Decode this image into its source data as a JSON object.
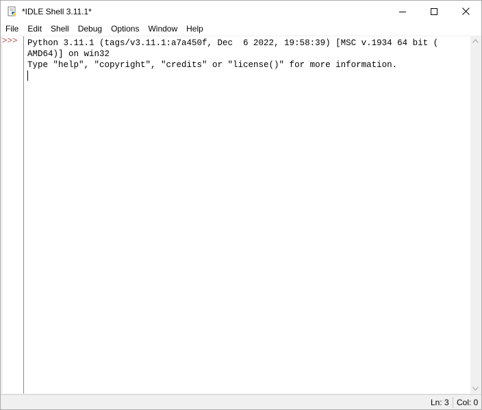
{
  "window": {
    "title": "*IDLE Shell 3.11.1*"
  },
  "menu": {
    "items": [
      "File",
      "Edit",
      "Shell",
      "Debug",
      "Options",
      "Window",
      "Help"
    ]
  },
  "shell": {
    "prompt": ">>>",
    "lines": [
      "Python 3.11.1 (tags/v3.11.1:a7a450f, Dec  6 2022, 19:58:39) [MSC v.1934 64 bit (",
      "AMD64)] on win32",
      "Type \"help\", \"copyright\", \"credits\" or \"license()\" for more information."
    ]
  },
  "status": {
    "ln": "Ln: 3",
    "col": "Col: 0"
  },
  "icons": {
    "app": "idle-app-icon",
    "minimize": "minimize-icon",
    "maximize": "maximize-icon",
    "close": "close-icon"
  }
}
